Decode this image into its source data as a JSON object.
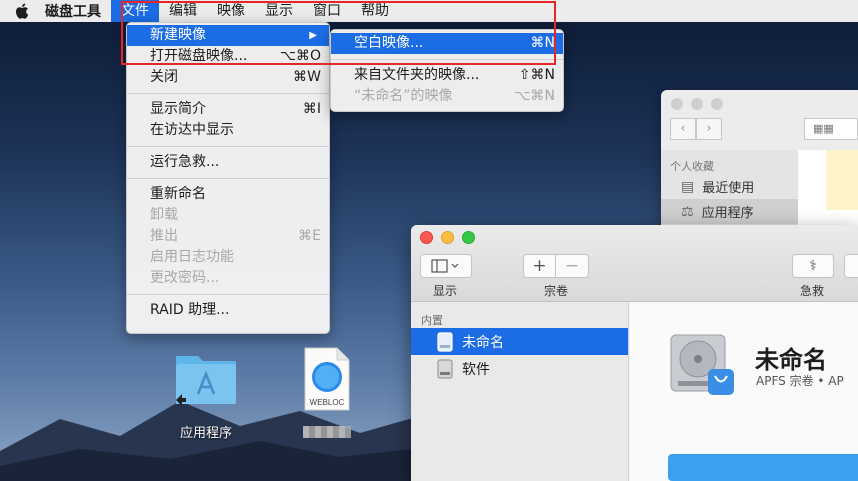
{
  "menubar": {
    "app_name": "磁盘工具",
    "items": [
      "文件",
      "编辑",
      "映像",
      "显示",
      "窗口",
      "帮助"
    ]
  },
  "file_menu": {
    "new_image": "新建映像",
    "open_image": "打开磁盘映像...",
    "open_image_shortcut": "⌥⌘O",
    "close": "关闭",
    "close_shortcut": "⌘W",
    "show_info": "显示简介",
    "show_info_shortcut": "⌘I",
    "show_in_finder": "在访达中显示",
    "first_aid": "运行急救...",
    "rename": "重新命名",
    "unmount": "卸载",
    "eject": "推出",
    "eject_shortcut": "⌘E",
    "enable_journaling": "启用日志功能",
    "change_password": "更改密码...",
    "raid_assistant": "RAID 助理..."
  },
  "submenu": {
    "blank_image": "空白映像...",
    "blank_image_shortcut": "⌘N",
    "from_folder": "来自文件夹的映像...",
    "from_folder_shortcut": "⇧⌘N",
    "from_volume": "“未命名”的映像",
    "from_volume_shortcut": "⌥⌘N"
  },
  "finder": {
    "sidebar_header": "个人收藏",
    "recent": "最近使用",
    "applications": "应用程序"
  },
  "disk_utility": {
    "view_label": "显示",
    "volume_label": "宗卷",
    "first_aid_label": "急救",
    "sidebar_header": "内置",
    "volumes": [
      "未命名",
      "软件"
    ],
    "volume_name": "未命名",
    "volume_subtitle": "APFS 宗卷 • AP"
  },
  "desktop": {
    "apps_folder_label": "应用程序",
    "webloc_badge": "WEBLOC"
  },
  "colors": {
    "highlight": "#1b6ce5",
    "annotation": "#e8262a"
  }
}
